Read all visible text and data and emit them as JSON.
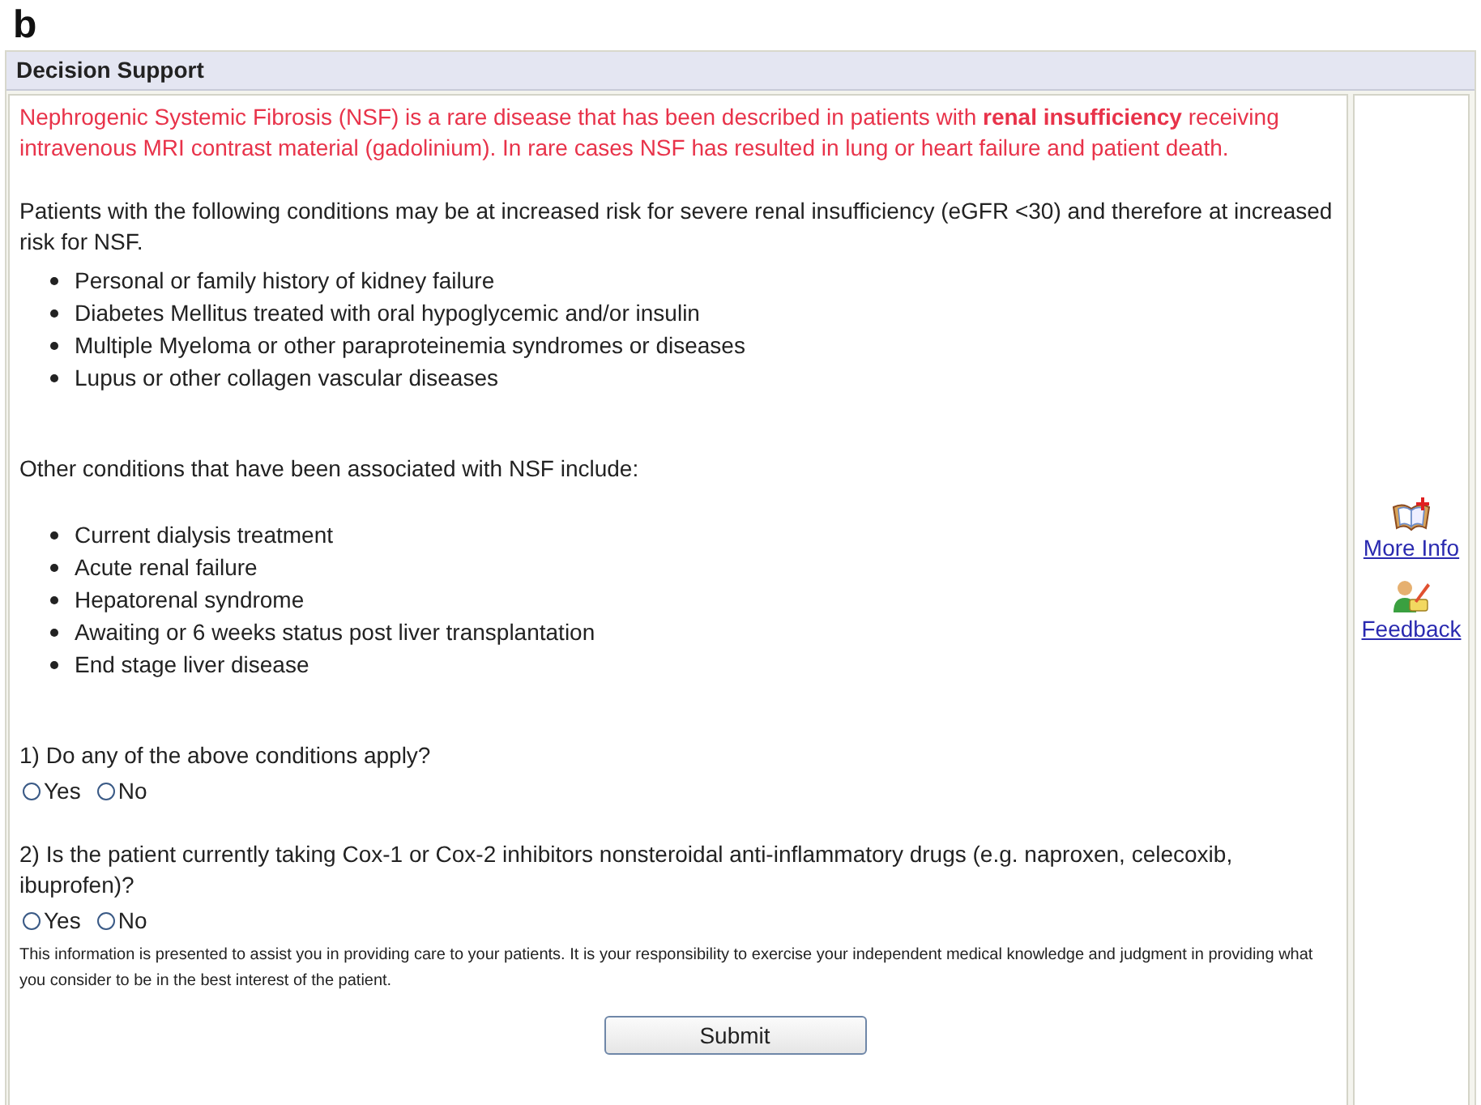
{
  "figure_label": "b",
  "panel": {
    "title": "Decision Support"
  },
  "warning": "Nephrogenic Systemic Fibrosis (NSF) is a rare disease that has been described in patients with **renal insufficiency** receiving intravenous MRI contrast material (gadolinium). In rare cases NSF has resulted in lung or heart failure and patient death.",
  "risk_intro": "Patients with the following conditions may be at increased risk for severe renal insufficiency (eGFR <30) and therefore at increased risk for NSF.",
  "risk_conditions": [
    "Personal or family history of kidney failure",
    "Diabetes Mellitus treated with oral hypoglycemic and/or insulin",
    "Multiple Myeloma or other paraproteinemia syndromes or diseases",
    "Lupus or other collagen vascular diseases"
  ],
  "associated_intro": "Other conditions that have been associated with NSF include:",
  "associated_conditions": [
    "Current dialysis treatment",
    "Acute renal failure",
    "Hepatorenal syndrome",
    "Awaiting or 6 weeks status post liver transplantation",
    "End stage liver disease"
  ],
  "questions": [
    {
      "text": "1) Do any of the above conditions apply?",
      "options": [
        {
          "label": "Yes",
          "selected": false
        },
        {
          "label": "No",
          "selected": false
        }
      ]
    },
    {
      "text": "2) Is the patient currently taking Cox-1 or Cox-2 inhibitors nonsteroidal anti-inflammatory drugs (e.g. naproxen, celecoxib, ibuprofen)?",
      "options": [
        {
          "label": "Yes",
          "selected": false
        },
        {
          "label": "No",
          "selected": false
        }
      ]
    }
  ],
  "disclaimer": "This information is presented to assist you in providing care to your patients. It is your responsibility to exercise your independent medical knowledge and judgment in providing what you consider to be in the best interest of the patient.",
  "submit": "Submit",
  "sidebar": {
    "links": [
      {
        "kind": "book",
        "label": "More Info"
      },
      {
        "kind": "feedback",
        "label": "Feedback"
      }
    ]
  }
}
